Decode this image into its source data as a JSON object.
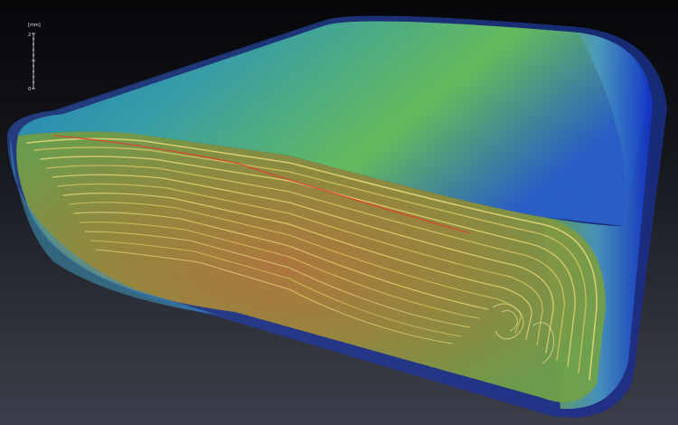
{
  "scale_bar": {
    "unit": "[mm]",
    "top_label": "2",
    "bottom_label": "0"
  }
}
